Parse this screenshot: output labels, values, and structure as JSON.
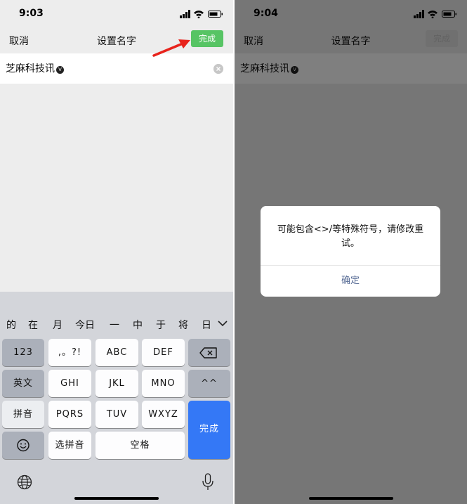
{
  "left": {
    "status": {
      "time": "9:03"
    },
    "nav": {
      "cancel": "取消",
      "title": "设置名字",
      "done": "完成"
    },
    "input": {
      "value": "芝麻科技讯",
      "badge": "V"
    },
    "keyboard": {
      "candidates": [
        "的",
        "在",
        "月",
        "今日",
        "一",
        "中",
        "于",
        "将",
        "日"
      ],
      "row1": [
        "123",
        ",。?!",
        "ABC",
        "DEF"
      ],
      "row2": [
        "英文",
        "GHI",
        "JKL",
        "MNO",
        "^^"
      ],
      "row3": [
        "拼音",
        "PQRS",
        "TUV",
        "WXYZ"
      ],
      "row4": [
        "选拼音",
        "空格"
      ],
      "done": "完成"
    }
  },
  "right": {
    "status": {
      "time": "9:04"
    },
    "nav": {
      "cancel": "取消",
      "title": "设置名字",
      "done": "完成"
    },
    "input": {
      "value": "芝麻科技讯",
      "badge": "V"
    },
    "dialog": {
      "message": "可能包含<>/等特殊符号，请修改重试。",
      "confirm": "确定"
    }
  },
  "colors": {
    "accent_green": "#57c464",
    "keyboard_blue": "#3478f6",
    "link_blue": "#576b95",
    "arrow_red": "#e8231c"
  },
  "icons": [
    "signal-icon",
    "wifi-icon",
    "battery-icon",
    "clear-icon",
    "verified-badge-icon",
    "red-arrow-icon",
    "chevron-down-icon",
    "backspace-icon",
    "emoji-icon",
    "globe-icon",
    "microphone-icon"
  ]
}
